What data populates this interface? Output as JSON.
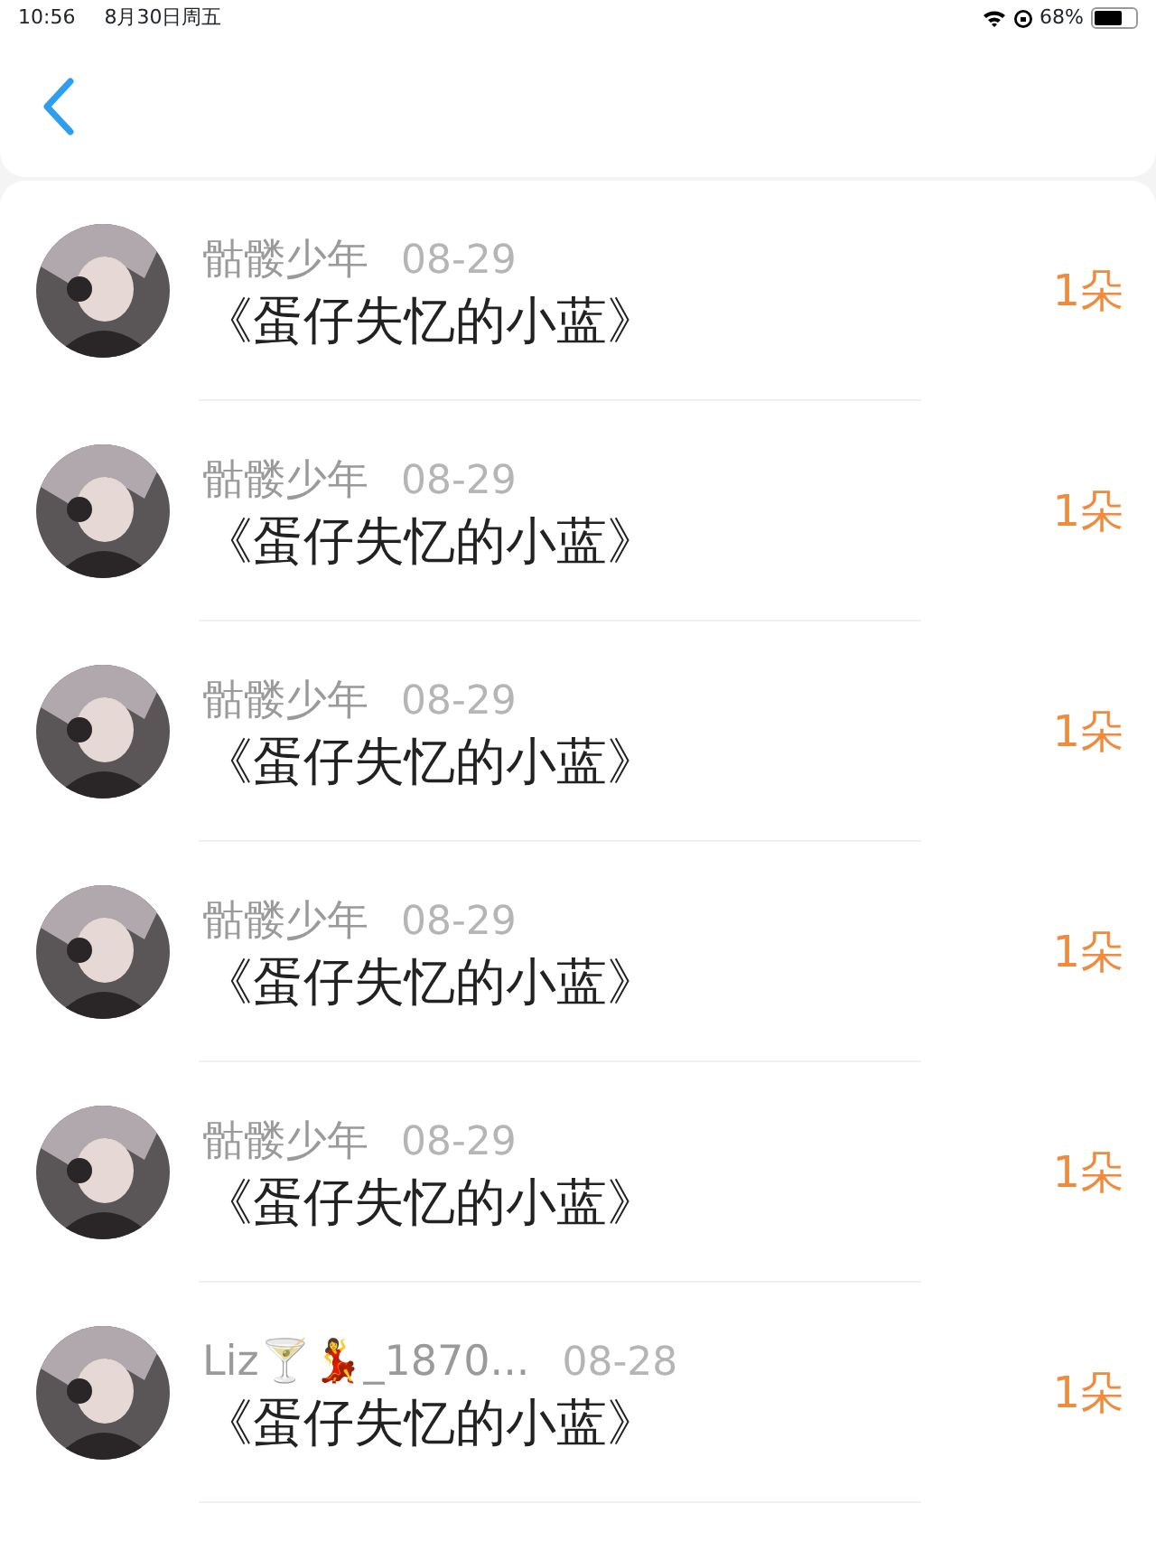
{
  "status_bar": {
    "time": "10:56",
    "date": "8月30日周五",
    "battery": "68%"
  },
  "items": [
    {
      "name": "骷髅少年",
      "date": "08-29",
      "title": "《蛋仔失忆的小蓝》",
      "amount": "1朵"
    },
    {
      "name": "骷髅少年",
      "date": "08-29",
      "title": "《蛋仔失忆的小蓝》",
      "amount": "1朵"
    },
    {
      "name": "骷髅少年",
      "date": "08-29",
      "title": "《蛋仔失忆的小蓝》",
      "amount": "1朵"
    },
    {
      "name": "骷髅少年",
      "date": "08-29",
      "title": "《蛋仔失忆的小蓝》",
      "amount": "1朵"
    },
    {
      "name": "骷髅少年",
      "date": "08-29",
      "title": "《蛋仔失忆的小蓝》",
      "amount": "1朵"
    },
    {
      "name": "Liz🍸💃_1870...",
      "date": "08-28",
      "title": "《蛋仔失忆的小蓝》",
      "amount": "1朵"
    }
  ]
}
